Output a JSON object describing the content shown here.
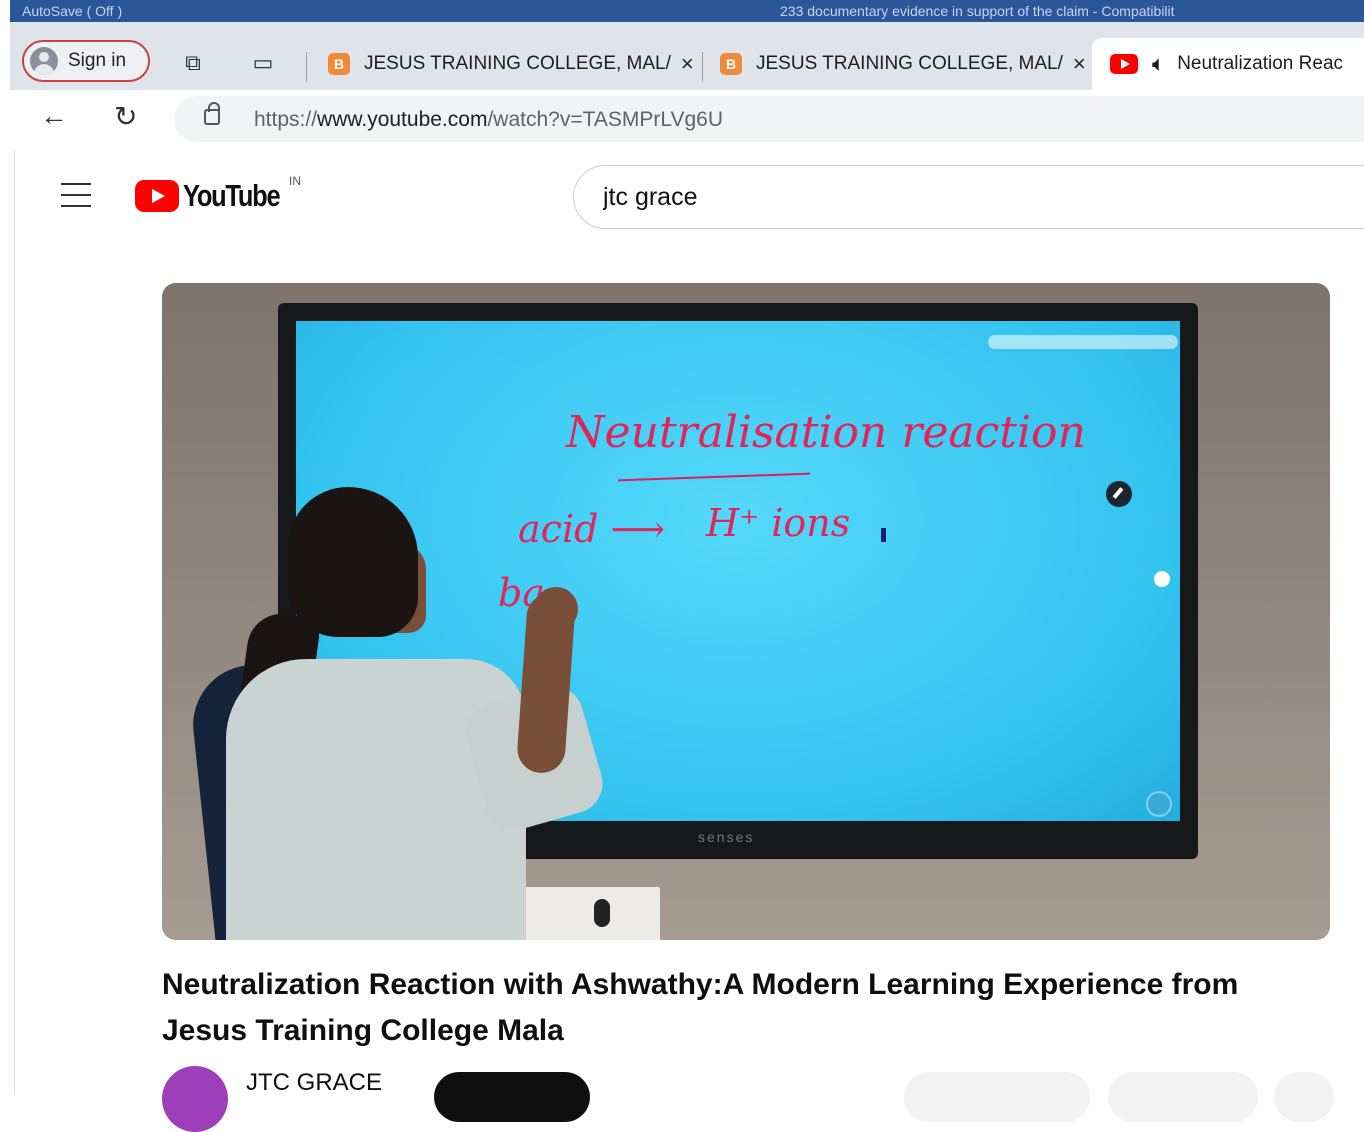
{
  "office_strip": {
    "left_text": "AutoSave ( Off ) ",
    "right_text": "233 documentary evidence in support of the claim - Compatibilit"
  },
  "browser": {
    "sign_in": "Sign in",
    "tabs": [
      {
        "title": "JESUS TRAINING COLLEGE, MAL/",
        "favicon": "blogger-icon",
        "close": "×"
      },
      {
        "title": "JESUS TRAINING COLLEGE, MAL/",
        "favicon": "blogger-icon",
        "close": "×"
      },
      {
        "title": "Neutralization Reac",
        "favicon": "youtube-icon",
        "audio": "speaker-icon"
      }
    ],
    "url": {
      "scheme": "https://",
      "host": "www.youtube.com",
      "path": "/watch?v=TASMPrLVg6U"
    }
  },
  "youtube": {
    "logo_word": "YouTube",
    "country_code": "IN",
    "search_value": "jtc grace",
    "video": {
      "board_title": "Neutralisation reaction",
      "board_line1_left": "acid ⟶",
      "board_line1_right": "H⁺ ions",
      "board_line2": "ba",
      "tv_brand": "senses"
    },
    "title": "Neutralization Reaction with Ashwathy:A Modern Learning Experience from Jesus Training College Mala",
    "channel_name": "JTC GRACE"
  }
}
